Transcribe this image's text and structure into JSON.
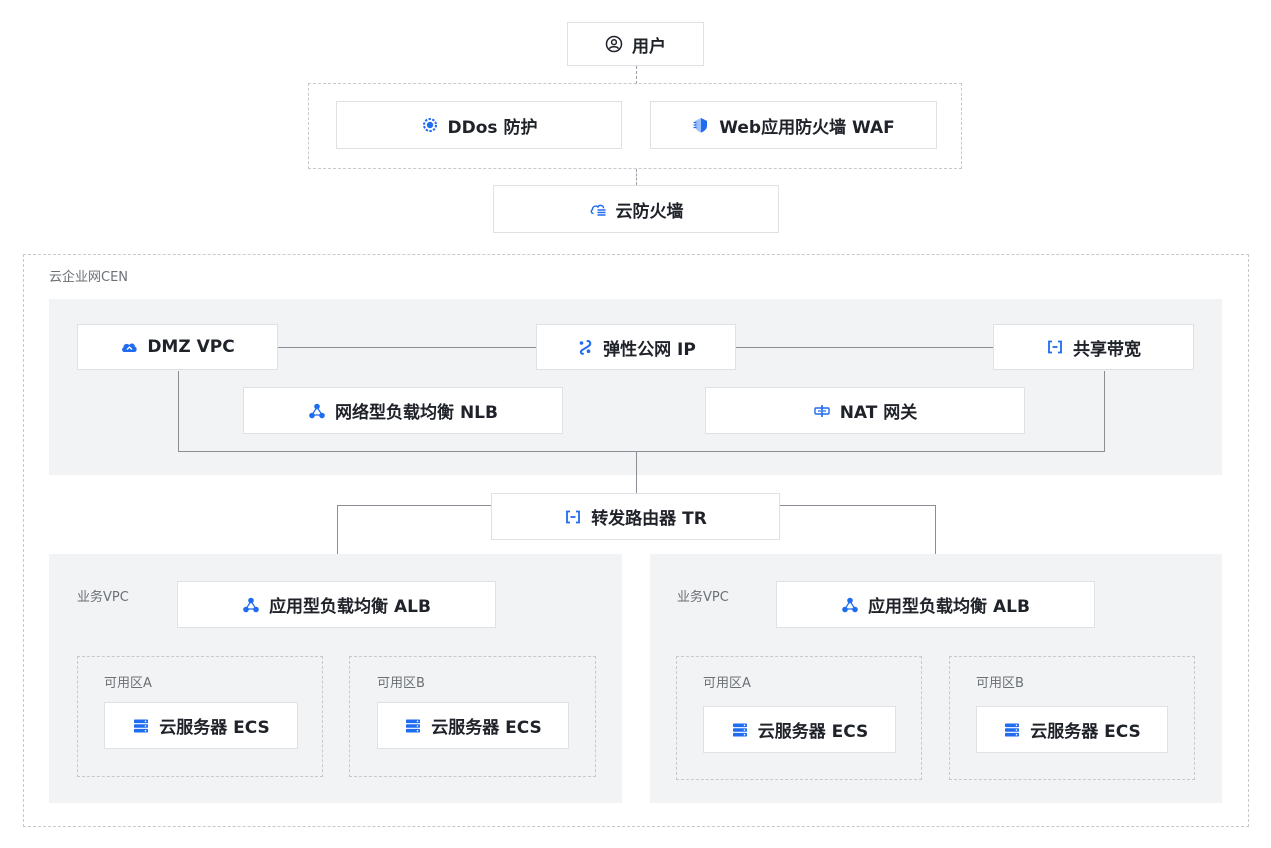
{
  "nodes": {
    "user": "用户",
    "ddos": "DDos 防护",
    "waf": "Web应用防火墙 WAF",
    "cloud_firewall": "云防火墙",
    "dmz_vpc": "DMZ VPC",
    "eip": "弹性公网 IP",
    "shared_bandwidth": "共享带宽",
    "nlb": "网络型负载均衡 NLB",
    "nat": "NAT 网关",
    "tr": "转发路由器 TR"
  },
  "labels": {
    "cen": "云企业网CEN"
  },
  "business_vpcs": [
    {
      "label": "业务VPC",
      "alb": "应用型负载均衡 ALB",
      "zones": [
        {
          "label": "可用区A",
          "ecs": "云服务器 ECS"
        },
        {
          "label": "可用区B",
          "ecs": "云服务器 ECS"
        }
      ]
    },
    {
      "label": "业务VPC",
      "alb": "应用型负载均衡 ALB",
      "zones": [
        {
          "label": "可用区A",
          "ecs": "云服务器 ECS"
        },
        {
          "label": "可用区B",
          "ecs": "云服务器 ECS"
        }
      ]
    }
  ],
  "colors": {
    "accent": "#1f6cf0",
    "panel": "#f2f3f5",
    "text": "#1f2329"
  },
  "icons": {
    "user": "user-circle-icon",
    "ddos": "shield-gear-icon",
    "waf": "firewall-shield-icon",
    "cloud_firewall": "cloud-firewall-icon",
    "dmz_vpc": "cloud-icon",
    "eip": "elastic-ip-icon",
    "shared_bandwidth": "bracket-link-icon",
    "nlb": "load-balancer-icon",
    "nat": "nat-gateway-icon",
    "tr": "bracket-link-icon",
    "alb": "load-balancer-icon",
    "ecs": "server-icon"
  }
}
